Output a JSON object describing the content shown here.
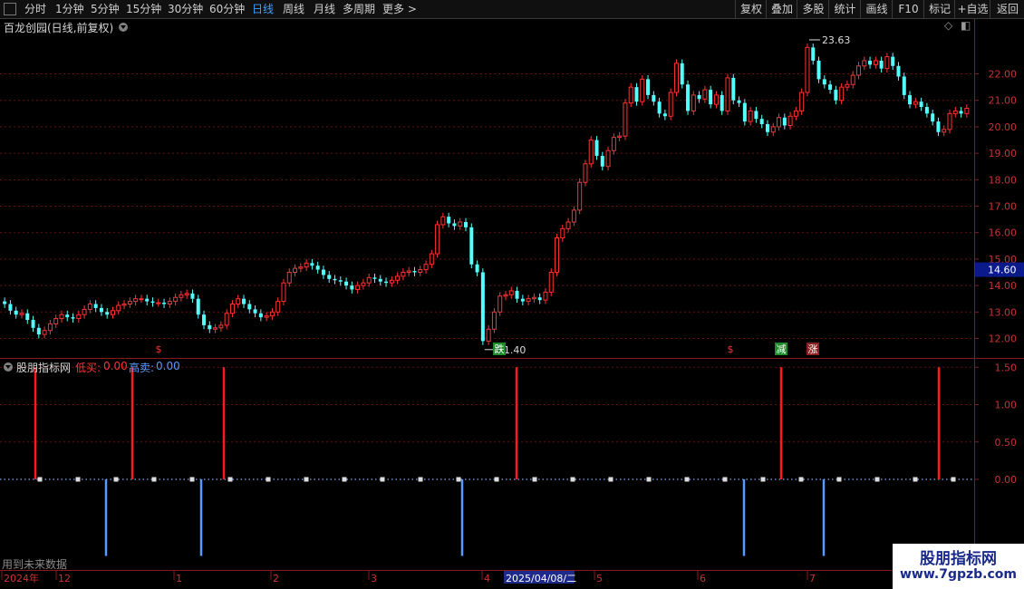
{
  "toolbar": {
    "left": [
      "分时",
      "1分钟",
      "5分钟",
      "15分钟",
      "30分钟",
      "60分钟",
      "日线",
      "周线",
      "月线",
      "多周期",
      "更多 >"
    ],
    "active_index": 6,
    "right": [
      "复权",
      "叠加",
      "多股",
      "统计",
      "画线",
      "F10",
      "标记",
      "+自选",
      "返回"
    ]
  },
  "main_panel": {
    "title": "百龙创园(日线,前复权)",
    "high_label": "23.63",
    "low_label": "11.40",
    "current_price": "14.60",
    "y_ticks": [
      "22.00",
      "21.00",
      "20.00",
      "19.00",
      "18.00",
      "17.00",
      "16.00",
      "15.00",
      "14.00",
      "13.00",
      "12.00"
    ],
    "signals": [
      {
        "text": "$",
        "kind": "dollar"
      },
      {
        "text": "跌",
        "kind": "green"
      },
      {
        "text": "$",
        "kind": "dollar"
      },
      {
        "text": "减",
        "kind": "green"
      },
      {
        "text": "涨",
        "kind": "red"
      }
    ]
  },
  "indicator_panel": {
    "name": "股朋指标网",
    "low_buy_label": "低买:",
    "low_buy_value": "0.00",
    "high_sell_label": "高卖:",
    "high_sell_value": "0.00",
    "y_ticks": [
      "1.50",
      "1.00",
      "0.50",
      "0.00"
    ],
    "footer_note": "用到未来数据"
  },
  "x_axis": {
    "labels": [
      "2024年",
      "12",
      "1",
      "2",
      "3",
      "4",
      "2025/04/08/二",
      "5",
      "6",
      "7"
    ]
  },
  "watermark": {
    "line1": "股朋指标网",
    "line2": "www.7gpzb.com"
  },
  "colors": {
    "up": "#ff3232",
    "down": "#54ffff",
    "grid": "#6a1010",
    "sell": "#5a9aff",
    "axis": "#8a1a1a"
  },
  "chart_data": {
    "type": "candlestick",
    "ylim": [
      11.4,
      23.8
    ],
    "candles_close": [
      13.3,
      13.05,
      12.9,
      12.95,
      12.7,
      12.4,
      12.15,
      12.3,
      12.55,
      12.75,
      12.9,
      12.8,
      12.75,
      12.9,
      13.1,
      13.3,
      13.15,
      13.0,
      12.9,
      13.05,
      13.25,
      13.3,
      13.4,
      13.5,
      13.5,
      13.4,
      13.35,
      13.35,
      13.3,
      13.4,
      13.55,
      13.65,
      13.7,
      13.5,
      12.9,
      12.5,
      12.35,
      12.4,
      12.5,
      12.95,
      13.3,
      13.5,
      13.3,
      13.1,
      12.95,
      12.8,
      12.85,
      13.0,
      13.4,
      14.1,
      14.5,
      14.65,
      14.7,
      14.85,
      14.75,
      14.6,
      14.4,
      14.25,
      14.2,
      14.15,
      14.0,
      13.85,
      14.0,
      14.1,
      14.3,
      14.25,
      14.15,
      14.1,
      14.2,
      14.35,
      14.5,
      14.55,
      14.5,
      14.6,
      14.8,
      15.2,
      16.3,
      16.6,
      16.35,
      16.25,
      16.4,
      16.2,
      14.8,
      14.5,
      11.9,
      12.35,
      13.0,
      13.6,
      13.65,
      13.8,
      13.5,
      13.4,
      13.5,
      13.55,
      13.45,
      13.75,
      14.5,
      15.8,
      16.15,
      16.4,
      16.85,
      17.9,
      18.6,
      19.5,
      18.9,
      18.5,
      19.1,
      19.6,
      19.65,
      20.9,
      21.5,
      20.95,
      21.8,
      21.2,
      20.95,
      20.5,
      20.4,
      21.3,
      22.4,
      21.6,
      20.6,
      21.2,
      21.05,
      21.4,
      20.85,
      21.2,
      20.6,
      21.85,
      21.0,
      20.9,
      20.2,
      20.6,
      20.3,
      20.1,
      19.8,
      20.0,
      20.35,
      20.05,
      20.4,
      20.6,
      21.3,
      23.0,
      22.5,
      21.8,
      21.6,
      21.4,
      21.0,
      21.5,
      21.6,
      21.95,
      22.3,
      22.5,
      22.35,
      22.5,
      22.2,
      22.65,
      22.3,
      21.9,
      21.2,
      20.85,
      20.95,
      20.75,
      20.5,
      20.2,
      19.8,
      19.9,
      20.5,
      20.6,
      20.5,
      20.7
    ],
    "low_buy_value": 1.5,
    "high_sell_value": -1.0
  }
}
